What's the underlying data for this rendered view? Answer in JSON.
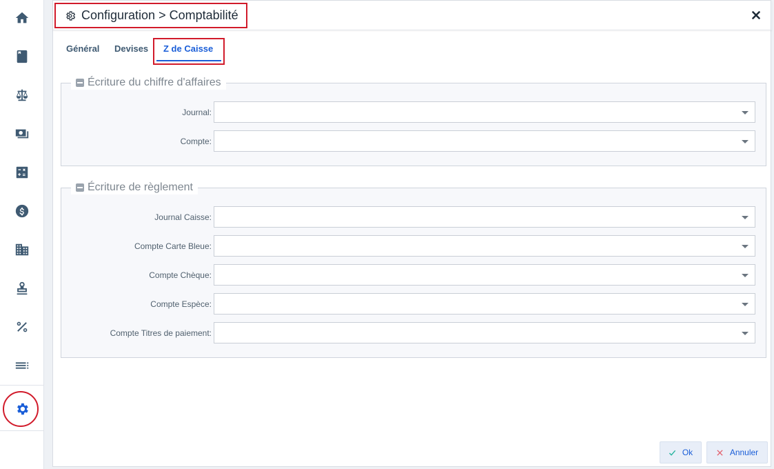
{
  "sidebar": {
    "items": [
      {
        "icon": "home-icon"
      },
      {
        "icon": "book-icon"
      },
      {
        "icon": "balance-scale-icon"
      },
      {
        "icon": "money-icon"
      },
      {
        "icon": "calculator-icon"
      },
      {
        "icon": "dollar-icon"
      },
      {
        "icon": "building-icon"
      },
      {
        "icon": "stamp-icon"
      },
      {
        "icon": "percent-icon"
      },
      {
        "icon": "list-icon"
      },
      {
        "icon": "gear-icon",
        "active": true
      }
    ],
    "accent": "#1a5ed8"
  },
  "dialog": {
    "title": "Configuration > Comptabilité",
    "title_icon": "gear-outline-icon",
    "close_icon": "close-icon"
  },
  "tabs": {
    "general": "Général",
    "devises": "Devises",
    "z_caisse": "Z de Caisse",
    "active": "z_caisse"
  },
  "sections": {
    "ca": {
      "legend": "Écriture du chiffre d'affaires",
      "journal_label": "Journal:",
      "journal_value": "",
      "compte_label": "Compte:",
      "compte_value": ""
    },
    "reglement": {
      "legend": "Écriture de règlement",
      "journal_caisse_label": "Journal Caisse:",
      "carte_bleue_label": "Compte Carte Bleue:",
      "cheque_label": "Compte Chèque:",
      "espece_label": "Compte Espèce:",
      "titres_label": "Compte Titres de paiement:"
    }
  },
  "footer": {
    "ok_label": "Ok",
    "cancel_label": "Annuler",
    "ok_icon": "check-icon",
    "cancel_icon": "x-icon"
  },
  "colors": {
    "highlight": "#d11a2a",
    "ok_check": "#2bb5a0",
    "cancel_x": "#e35d6a"
  }
}
